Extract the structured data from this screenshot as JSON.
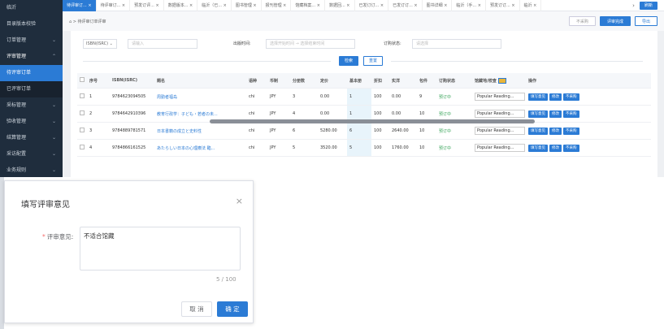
{
  "sidebar": {
    "items": [
      {
        "label": "临沂",
        "state": "normal"
      },
      {
        "label": "目录版本校验",
        "state": "normal"
      },
      {
        "label": "订单管理",
        "state": "normal",
        "chevron": "⌄"
      },
      {
        "label": "评审管理",
        "state": "open",
        "chevron": "⌃"
      },
      {
        "label": "待评审订单",
        "state": "active"
      },
      {
        "label": "已评审订单",
        "state": "sub"
      },
      {
        "label": "采标管理",
        "state": "normal",
        "chevron": "⌄"
      },
      {
        "label": "验收管理",
        "state": "normal",
        "chevron": "⌄"
      },
      {
        "label": "结算管理",
        "state": "normal",
        "chevron": "⌄"
      },
      {
        "label": "采访配置",
        "state": "normal",
        "chevron": "⌄"
      },
      {
        "label": "业务规则",
        "state": "normal",
        "chevron": "⌄"
      }
    ]
  },
  "tabs": [
    "待评审订... ×",
    "待评审订... ×",
    "预发订评... ×",
    "数据版本... ×",
    "临沂（已... ×",
    "图书管理 ×",
    "报刊管理 ×",
    "馆藏档案... ×",
    "数据回... ×",
    "已发订订... ×",
    "已发订订... ×",
    "图书详细 ×",
    "临沂（手... ×",
    "预发订订... ×",
    "临沂 ×"
  ],
  "tab_next": "›",
  "refresh_label": "刷新",
  "breadcrumb": "⌂ > 待评审订单评审",
  "actions": {
    "reject": "不采购",
    "review_done": "评审完成",
    "export": "导出"
  },
  "filters": {
    "isbn_select": "ISBN(ISRC)",
    "isbn_placeholder": "请输入",
    "date_label": "出版时间:",
    "date_start": "选择开始时间",
    "date_sep": "→",
    "date_end": "选择结束时间",
    "status_label": "订购状态:",
    "status_placeholder": "请选择",
    "search": "检索",
    "reset": "重置"
  },
  "table": {
    "headers": [
      "",
      "序号",
      "ISBN(ISRC)",
      "题名",
      "",
      "语种",
      "币制",
      "分册数",
      "定价",
      "基本册",
      "折扣",
      "实洋",
      "包件",
      "订购状态",
      "馆藏地/校查",
      "操作"
    ],
    "rows": [
      {
        "no": "1",
        "isbn": "9784623094505",
        "title": "周勤者福岛",
        "lang": "chi",
        "cur": "JPY",
        "split": "3",
        "price": "0.00",
        "base": "1",
        "disc": "100",
        "real": "0.00",
        "pack": "9",
        "status": "预订中",
        "cat": "Popular Reading..."
      },
      {
        "no": "2",
        "isbn": "9784642910396",
        "title": "教育行政学：子ども・若者の未...",
        "lang": "chi",
        "cur": "JPY",
        "split": "4",
        "price": "0.00",
        "base": "1",
        "disc": "100",
        "real": "0.00",
        "pack": "10",
        "status": "预订中",
        "cat": "Popular Reading..."
      },
      {
        "no": "3",
        "isbn": "9784889781571",
        "title": "日本書籍の成立と史料性",
        "lang": "chi",
        "cur": "JPY",
        "split": "6",
        "price": "5280.00",
        "base": "6",
        "disc": "100",
        "real": "2640.00",
        "pack": "10",
        "status": "预订中",
        "cat": "Popular Reading..."
      },
      {
        "no": "4",
        "isbn": "9784866161525",
        "title": "あたらしい日本の心理療法 臨...",
        "lang": "chi",
        "cur": "JPY",
        "split": "5",
        "price": "3520.00",
        "base": "5",
        "disc": "100",
        "real": "1760.00",
        "pack": "10",
        "status": "预订中",
        "cat": "Popular Reading..."
      }
    ],
    "ops": {
      "fill": "填写意见",
      "edit": "修改",
      "reject": "不采购"
    }
  },
  "dialog": {
    "title": "填写评审意见",
    "label": "评审意见:",
    "value": "不适合馆藏",
    "count": "5 / 100",
    "cancel": "取 消",
    "confirm": "确 定"
  },
  "colors": {
    "primary": "#2b7bd5",
    "sidebar": "#1f2d3d",
    "status_green": "#3aa55b"
  }
}
